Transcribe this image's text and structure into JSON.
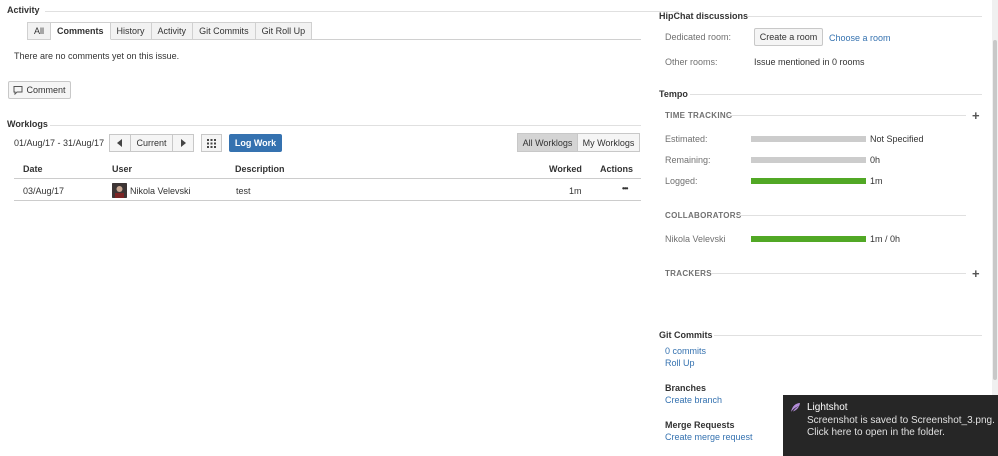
{
  "activity": {
    "title": "Activity",
    "tabs": [
      "All",
      "Comments",
      "History",
      "Activity",
      "Git Commits",
      "Git Roll Up"
    ],
    "empty_message": "There are no comments yet on this issue.",
    "comment_button": "Comment"
  },
  "worklogs": {
    "title": "Worklogs",
    "date_range": "01/Aug/17 - 31/Aug/17",
    "current_label": "Current",
    "log_work_label": "Log Work",
    "all_worklogs_label": "All Worklogs",
    "my_worklogs_label": "My Worklogs",
    "columns": {
      "date": "Date",
      "user": "User",
      "description": "Description",
      "worked": "Worked",
      "actions": "Actions"
    },
    "rows": [
      {
        "date": "03/Aug/17",
        "user": "Nikola Velevski",
        "description": "test",
        "worked": "1m",
        "actions": "•••"
      }
    ]
  },
  "hipchat": {
    "title": "HipChat discussions",
    "dedicated_label": "Dedicated room:",
    "create_room": "Create a room",
    "choose_room": "Choose a room",
    "other_label": "Other rooms:",
    "other_value": "Issue mentioned in 0 rooms"
  },
  "tempo": {
    "title": "Tempo",
    "time_tracking": "TIME TRACKING",
    "estimated_label": "Estimated:",
    "estimated_value": "Not Specified",
    "remaining_label": "Remaining:",
    "remaining_value": "0h",
    "logged_label": "Logged:",
    "logged_value": "1m",
    "collaborators": "COLLABORATORS",
    "collaborator_name": "Nikola Velevski",
    "collaborator_value": "1m / 0h",
    "trackers": "TRACKERS",
    "plus": "+"
  },
  "git": {
    "title": "Git Commits",
    "commits_link": "0 commits",
    "rollup_link": "Roll Up",
    "branches_title": "Branches",
    "create_branch": "Create branch",
    "merge_title": "Merge Requests",
    "create_merge": "Create merge request"
  },
  "toast": {
    "title": "Lightshot",
    "line1": "Screenshot is saved to Screenshot_3.png.",
    "line2": "Click here to open in the folder."
  },
  "colors": {
    "link": "#3572b0",
    "primary_button": "#3572b0",
    "progress_green": "#51a825",
    "progress_grey": "#cccccc",
    "toast_bg": "#262626"
  }
}
